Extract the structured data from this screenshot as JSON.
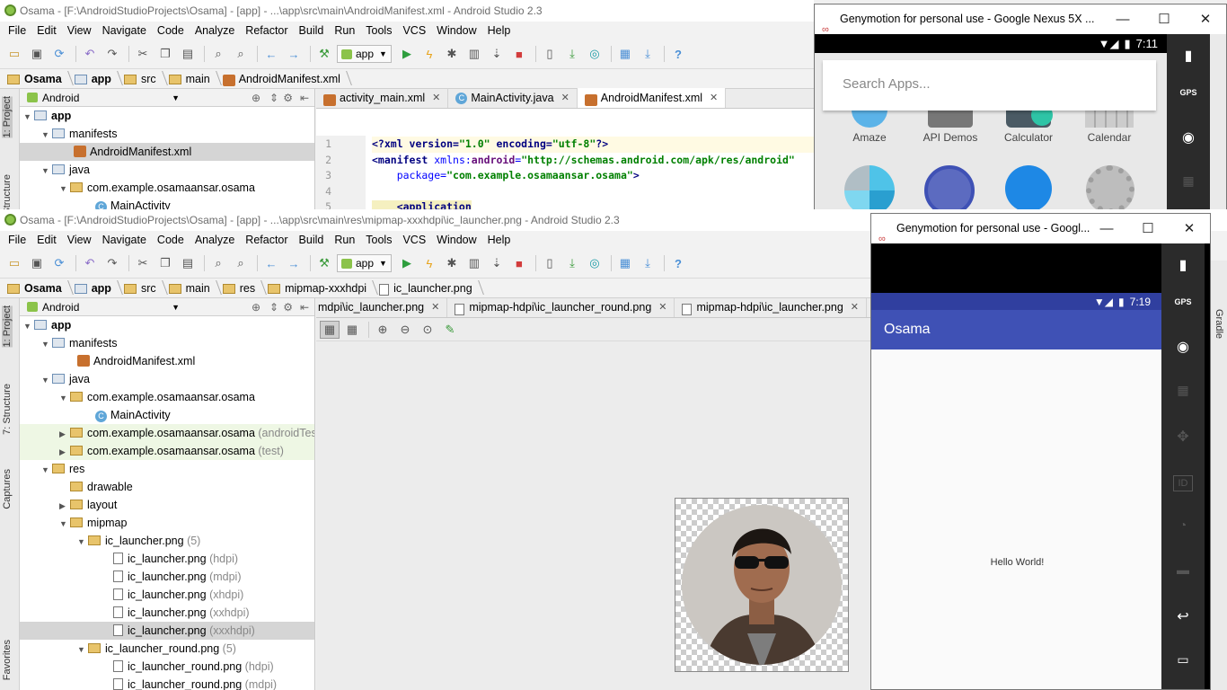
{
  "top_ide": {
    "title": "Osama - [F:\\AndroidStudioProjects\\Osama] - [app] - ...\\app\\src\\main\\AndroidManifest.xml - Android Studio 2.3",
    "menu": [
      "File",
      "Edit",
      "View",
      "Navigate",
      "Code",
      "Analyze",
      "Refactor",
      "Build",
      "Run",
      "Tools",
      "VCS",
      "Window",
      "Help"
    ],
    "run_config": "app",
    "breadcrumb": [
      "Osama",
      "app",
      "src",
      "main",
      "AndroidManifest.xml"
    ],
    "project_view": "Android",
    "tree": [
      {
        "label": "app",
        "level": 0
      },
      {
        "label": "manifests",
        "level": 1
      },
      {
        "label": "AndroidManifest.xml",
        "level": 2
      },
      {
        "label": "java",
        "level": 1
      },
      {
        "label": "com.example.osamaansar.osama",
        "level": 2
      },
      {
        "label": "MainActivity",
        "level": 3
      }
    ],
    "tabs": [
      "activity_main.xml",
      "MainActivity.java",
      "AndroidManifest.xml"
    ],
    "code_lines": [
      "1",
      "2",
      "3",
      "4",
      "5"
    ],
    "code": {
      "l1a": "<?xml version=",
      "l1b": "\"1.0\"",
      "l1c": " encoding=",
      "l1d": "\"utf-8\"",
      "l1e": "?>",
      "l2a": "<manifest ",
      "l2b": "xmlns:",
      "l2c": "android",
      "l2d": "=",
      "l2e": "\"http://schemas.android.com/apk/res/android\"",
      "l3a": "    package=",
      "l3b": "\"com.example.osamaansar.osama\"",
      "l3c": ">",
      "l5": "    <application"
    },
    "side_tabs": [
      "1: Project",
      "Structure"
    ]
  },
  "bottom_ide": {
    "title": "Osama - [F:\\AndroidStudioProjects\\Osama] - [app] - ...\\app\\src\\main\\res\\mipmap-xxxhdpi\\ic_launcher.png - Android Studio 2.3",
    "menu": [
      "File",
      "Edit",
      "View",
      "Navigate",
      "Code",
      "Analyze",
      "Refactor",
      "Build",
      "Run",
      "Tools",
      "VCS",
      "Window",
      "Help"
    ],
    "run_config": "app",
    "breadcrumb": [
      "Osama",
      "app",
      "src",
      "main",
      "res",
      "mipmap-xxxhdpi",
      "ic_launcher.png"
    ],
    "project_view": "Android",
    "tree": [
      {
        "label": "app",
        "sub": ""
      },
      {
        "label": "manifests",
        "sub": ""
      },
      {
        "label": "AndroidManifest.xml",
        "sub": ""
      },
      {
        "label": "java",
        "sub": ""
      },
      {
        "label": "com.example.osamaansar.osama",
        "sub": ""
      },
      {
        "label": "MainActivity",
        "sub": ""
      },
      {
        "label": "com.example.osamaansar.osama",
        "sub": "(androidTest)"
      },
      {
        "label": "com.example.osamaansar.osama",
        "sub": "(test)"
      },
      {
        "label": "res",
        "sub": ""
      },
      {
        "label": "drawable",
        "sub": ""
      },
      {
        "label": "layout",
        "sub": ""
      },
      {
        "label": "mipmap",
        "sub": ""
      },
      {
        "label": "ic_launcher.png",
        "sub": "(5)"
      },
      {
        "label": "ic_launcher.png",
        "sub": "(hdpi)"
      },
      {
        "label": "ic_launcher.png",
        "sub": "(mdpi)"
      },
      {
        "label": "ic_launcher.png",
        "sub": "(xhdpi)"
      },
      {
        "label": "ic_launcher.png",
        "sub": "(xxhdpi)"
      },
      {
        "label": "ic_launcher.png",
        "sub": "(xxxhdpi)"
      },
      {
        "label": "ic_launcher_round.png",
        "sub": "(5)"
      },
      {
        "label": "ic_launcher_round.png",
        "sub": "(hdpi)"
      },
      {
        "label": "ic_launcher_round.png",
        "sub": "(mdpi)"
      }
    ],
    "tabs": [
      "mdpi\\ic_launcher.png",
      "mipmap-hdpi\\ic_launcher_round.png",
      "mipmap-hdpi\\ic_launcher.png"
    ],
    "side_tabs": [
      "1: Project",
      "7: Structure",
      "Captures",
      "Favorites"
    ],
    "right_tab": "Gradle"
  },
  "geny_top": {
    "title": "Genymotion for personal use - Google Nexus 5X ...",
    "time": "7:11",
    "search_placeholder": "Search Apps...",
    "apps_row1": [
      "Amaze",
      "API Demos",
      "Calculator",
      "Calendar"
    ],
    "gps": "GPS"
  },
  "geny_bottom": {
    "title": "Genymotion for personal use - Googl...",
    "time": "7:19",
    "app_title": "Osama",
    "hello": "Hello World!",
    "gps": "GPS",
    "id": "ID"
  },
  "colors": {
    "appbar": "#3f51b5",
    "statusbar": "#303f9f",
    "android_green": "#8bc34a"
  }
}
